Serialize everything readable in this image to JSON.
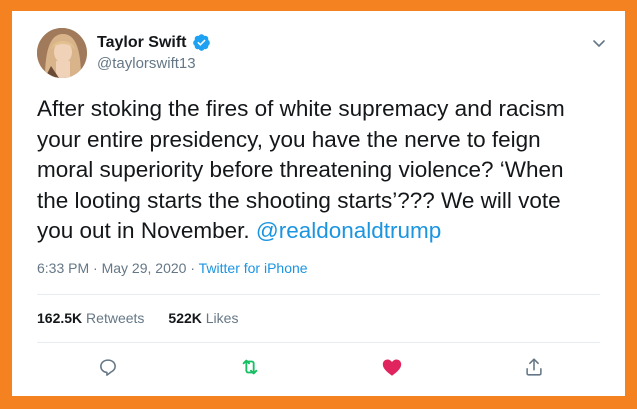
{
  "author": {
    "name": "Taylor Swift",
    "handle": "@taylorswift13",
    "verified_icon": "verified-badge-icon"
  },
  "tweet": {
    "text": "After stoking the fires of white supremacy and racism your entire presidency, you have the nerve to feign moral superiority before threatening violence? ‘When the looting starts the shooting starts’??? We will vote you out in November. ",
    "mention": "@realdonaldtrump"
  },
  "meta": {
    "time": "6:33 PM",
    "separator": " · ",
    "date": "May 29, 2020",
    "source": "Twitter for iPhone"
  },
  "stats": {
    "retweets_count": "162.5K",
    "retweets_label": "Retweets",
    "likes_count": "522K",
    "likes_label": "Likes"
  },
  "actions": {
    "reply_icon": "reply-icon",
    "retweet_icon": "retweet-icon",
    "like_icon": "heart-icon",
    "share_icon": "share-icon"
  },
  "colors": {
    "border": "#f58220",
    "link": "#1b95e0",
    "retweet_active": "#17bf63",
    "like_active": "#e0245e",
    "muted": "#657786",
    "verified": "#1da1f2"
  }
}
